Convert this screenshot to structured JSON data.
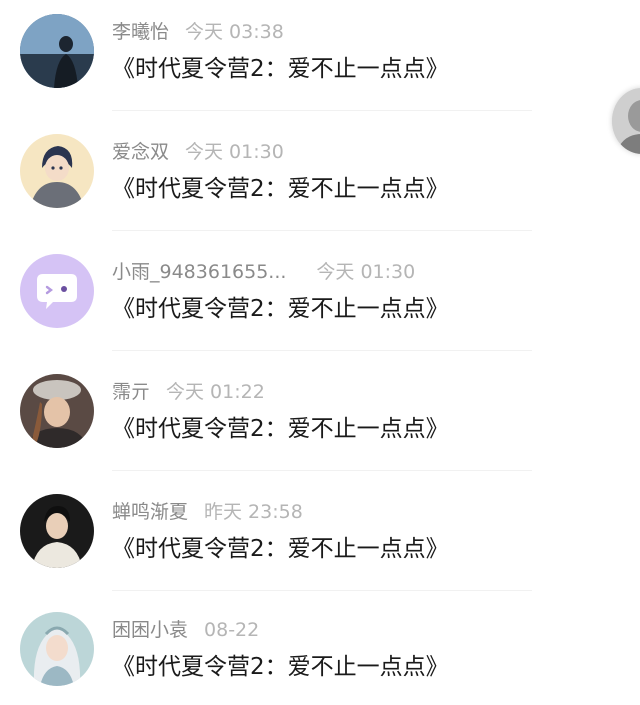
{
  "messages": [
    {
      "name": "李曦怡",
      "time": "今天 03:38",
      "title": "《时代夏令营2：爱不止一点点》",
      "avatar_icon": "avatar-photo-night-portrait"
    },
    {
      "name": "爱念双",
      "time": "今天 01:30",
      "title": "《时代夏令营2：爱不止一点点》",
      "avatar_icon": "avatar-anime-boy"
    },
    {
      "name": "小雨_948361655...",
      "time": "今天 01:30",
      "title": "《时代夏令营2：爱不止一点点》",
      "avatar_icon": "avatar-default-chat-bubble",
      "avatar_color": "#d5c3f5"
    },
    {
      "name": "霈亓",
      "time": "今天 01:22",
      "title": "《时代夏令营2：爱不止一点点》",
      "avatar_icon": "avatar-photo-girl-hat"
    },
    {
      "name": "蝉鸣渐夏",
      "time": "昨天 23:58",
      "title": "《时代夏令营2：爱不止一点点》",
      "avatar_icon": "avatar-photo-boy"
    },
    {
      "name": "困困小袁",
      "time": "08-22",
      "title": "《时代夏令营2：爱不止一点点》",
      "avatar_icon": "avatar-anime-girl"
    }
  ]
}
